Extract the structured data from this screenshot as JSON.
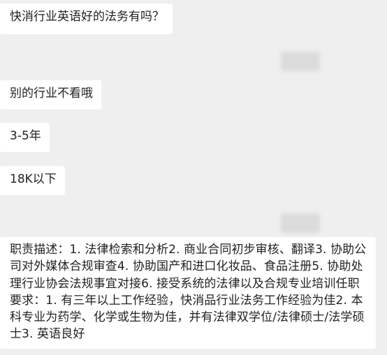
{
  "chat": {
    "messages": [
      {
        "text": "快消行业英语好的法务有吗？"
      },
      {
        "text": "别的行业不看哦"
      },
      {
        "text": "3-5年"
      },
      {
        "text": "18K以下"
      },
      {
        "text": "职责描述：1. 法律检索和分析2. 商业合同初步审核、翻译3. 协助公司对外媒体合规审查4. 协助国产和进口化妆品、食品注册5. 协助处理行业协会法规事宜对接6. 接受系统的法律以及合规专业培训任职要求：1. 有三年以上工作经验，快消品行业法务工作经验为佳2. 本科专业为药学、化学或生物为佳，并有法律双学位/法律硕士/法学硕士3. 英语良好"
      }
    ]
  }
}
